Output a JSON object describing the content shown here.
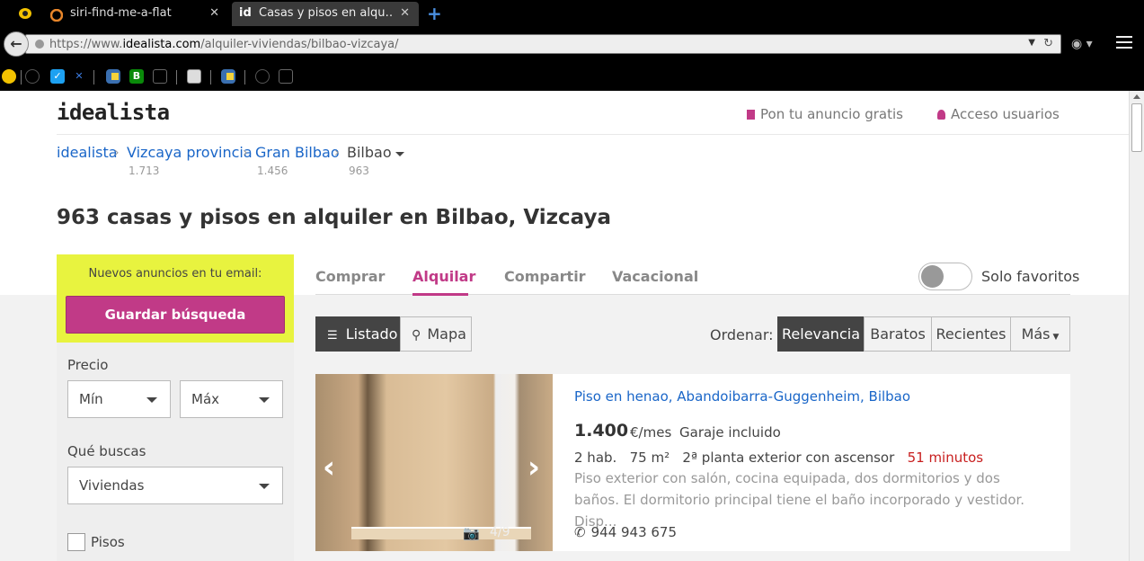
{
  "browser": {
    "tabs": [
      {
        "title": "siri-find-me-a-flat",
        "active": false
      },
      {
        "title": "Casas y pisos en alqu…",
        "active": true
      }
    ],
    "url_prefix": "https://www.",
    "url_domain": "idealista.com",
    "url_path": "/alquiler-viviendas/bilbao-vizcaya/"
  },
  "header": {
    "logo": "idealista",
    "post_ad": "Pon tu anuncio gratis",
    "login": "Acceso usuarios"
  },
  "breadcrumb": [
    {
      "label": "idealista",
      "count": ""
    },
    {
      "label": "Vizcaya provincia",
      "count": "1.713"
    },
    {
      "label": "Gran Bilbao",
      "count": "1.456"
    },
    {
      "label": "Bilbao",
      "count": "963"
    }
  ],
  "headline": {
    "count": "963",
    "text": "casas y pisos en alquiler en Bilbao, Vizcaya"
  },
  "sidebar": {
    "alert_text": "Nuevos anuncios en tu email:",
    "save_search": "Guardar búsqueda",
    "price_label": "Precio",
    "price_min": "Mín",
    "price_max": "Máx",
    "type_label": "Qué buscas",
    "type_value": "Viviendas",
    "checkbox_label": "Pisos"
  },
  "operation_tabs": [
    "Comprar",
    "Alquilar",
    "Compartir",
    "Vacacional"
  ],
  "active_tab": "Alquilar",
  "favorites_label": "Solo favoritos",
  "view": {
    "list": "Listado",
    "map": "Mapa"
  },
  "sort": {
    "label": "Ordenar:",
    "options": [
      "Relevancia",
      "Baratos",
      "Recientes",
      "Más"
    ],
    "active": "Relevancia"
  },
  "listing": {
    "title": "Piso en henao, Abandoibarra-Guggenheim, Bilbao",
    "price": "1.400",
    "price_unit": "€/mes",
    "price_extra": "Garaje incluido",
    "rooms": "2 hab.",
    "size": "75 m²",
    "floor": "2ª planta exterior con ascensor",
    "time": "51 minutos",
    "description": "Piso exterior con salón, cocina equipada, dos dormitorios y dos baños. El dormitorio principal tiene el baño incorporado y vestidor. Disp...",
    "phone": "944 943 675",
    "photo_count": "4/9"
  },
  "colors": {
    "brand": "#c13a87",
    "link": "#1a66c8",
    "alert_bg": "#e8f33f",
    "time": "#c81f1f"
  }
}
